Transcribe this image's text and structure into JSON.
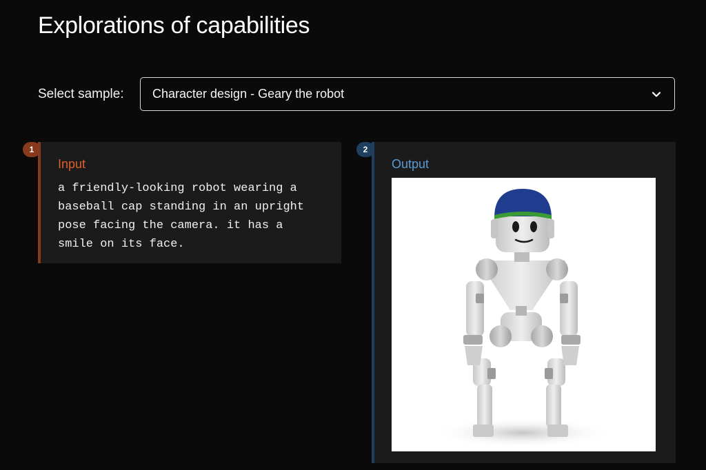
{
  "header": {
    "title": "Explorations of capabilities"
  },
  "sample_select": {
    "label": "Select sample:",
    "selected": "Character design - Geary the robot"
  },
  "input_panel": {
    "badge": "1",
    "heading": "Input",
    "text": "a friendly-looking robot wearing a\nbaseball cap standing in an upright\npose facing the camera. it has a\nsmile on its face."
  },
  "output_panel": {
    "badge": "2",
    "heading": "Output",
    "image_subject": "robot-image"
  },
  "colors": {
    "background": "#0a0a0a",
    "panel": "#1b1b1b",
    "input_accent": "#e0602c",
    "input_bar": "#8a3a1c",
    "output_accent": "#5a9bd5",
    "output_bar": "#1f3f5f"
  }
}
